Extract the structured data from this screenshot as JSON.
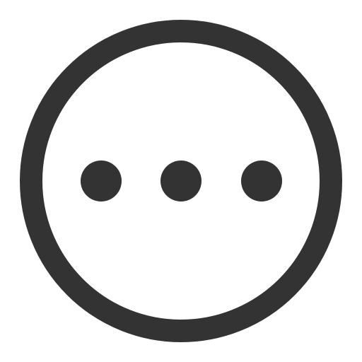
{
  "icon": {
    "name": "more-options-circle-icon",
    "stroke_color": "#333333",
    "fill_color": "#ffffff",
    "dot_count": 3
  }
}
